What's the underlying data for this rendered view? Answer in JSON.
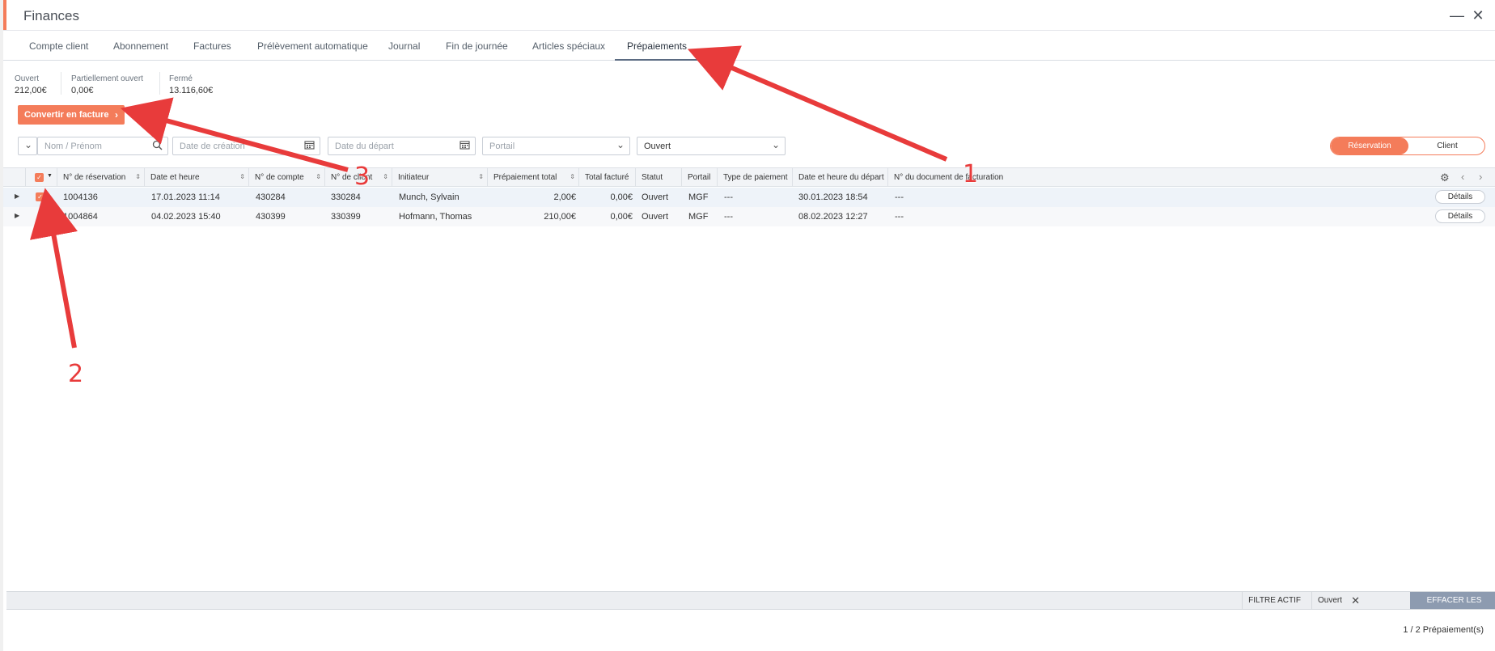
{
  "window": {
    "title": "Finances",
    "minimize_glyph": "—",
    "close_glyph": "✕"
  },
  "tabs": [
    {
      "label": "Compte client"
    },
    {
      "label": "Abonnement"
    },
    {
      "label": "Factures"
    },
    {
      "label": "Prélèvement automatique"
    },
    {
      "label": "Journal"
    },
    {
      "label": "Fin de journée"
    },
    {
      "label": "Articles spéciaux"
    },
    {
      "label": "Prépaiements",
      "active": true
    }
  ],
  "summary": {
    "open_label": "Ouvert",
    "open_value": "212,00€",
    "partial_label": "Partiellement ouvert",
    "partial_value": "0,00€",
    "closed_label": "Fermé",
    "closed_value": "13.116,60€"
  },
  "convert_button": {
    "label": "Convertir en facture"
  },
  "filters": {
    "name_placeholder": "Nom / Prénom",
    "created_placeholder": "Date de création",
    "departure_placeholder": "Date du départ",
    "portal_placeholder": "Portail",
    "status_value": "Ouvert"
  },
  "view_toggle": {
    "reservation": "Réservation",
    "client": "Client"
  },
  "table": {
    "headers": {
      "reservation_no": "N° de réservation",
      "date_time": "Date et heure",
      "account_no": "N° de compte",
      "client_no": "N° de client",
      "initiator": "Initiateur",
      "prepayment_total": "Prépaiement total",
      "billed_total": "Total facturé",
      "status": "Statut",
      "portal": "Portail",
      "payment_type": "Type de paiement",
      "departure": "Date et heure du départ",
      "invoice_doc": "N° du document de facturation"
    },
    "rows": [
      {
        "reservation_no": "1004136",
        "date_time": "17.01.2023 11:14",
        "account_no": "430284",
        "client_no": "330284",
        "initiator": "Munch, Sylvain",
        "prepayment_total": "2,00€",
        "billed_total": "0,00€",
        "status": "Ouvert",
        "portal": "MGF",
        "payment_type": "---",
        "departure": "30.01.2023 18:54",
        "invoice_doc": "---",
        "details": "Détails",
        "checked": true
      },
      {
        "reservation_no": "1004864",
        "date_time": "04.02.2023 15:40",
        "account_no": "430399",
        "client_no": "330399",
        "initiator": "Hofmann, Thomas",
        "prepayment_total": "210,00€",
        "billed_total": "0,00€",
        "status": "Ouvert",
        "portal": "MGF",
        "payment_type": "---",
        "departure": "08.02.2023 12:27",
        "invoice_doc": "---",
        "details": "Détails",
        "checked": false
      }
    ]
  },
  "footer": {
    "active_filter_label": "FILTRE ACTIF",
    "active_filter_value": "Ouvert",
    "clear_filters": "EFFACER LES FILTRES",
    "count": "1 / 2 Prépaiement(s)"
  },
  "annotations": {
    "n1": "1",
    "n2": "2",
    "n3": "3",
    "color": "#e83b3b"
  },
  "colors": {
    "accent": "#f47c5a",
    "clear_button": "#8d9bb0"
  }
}
